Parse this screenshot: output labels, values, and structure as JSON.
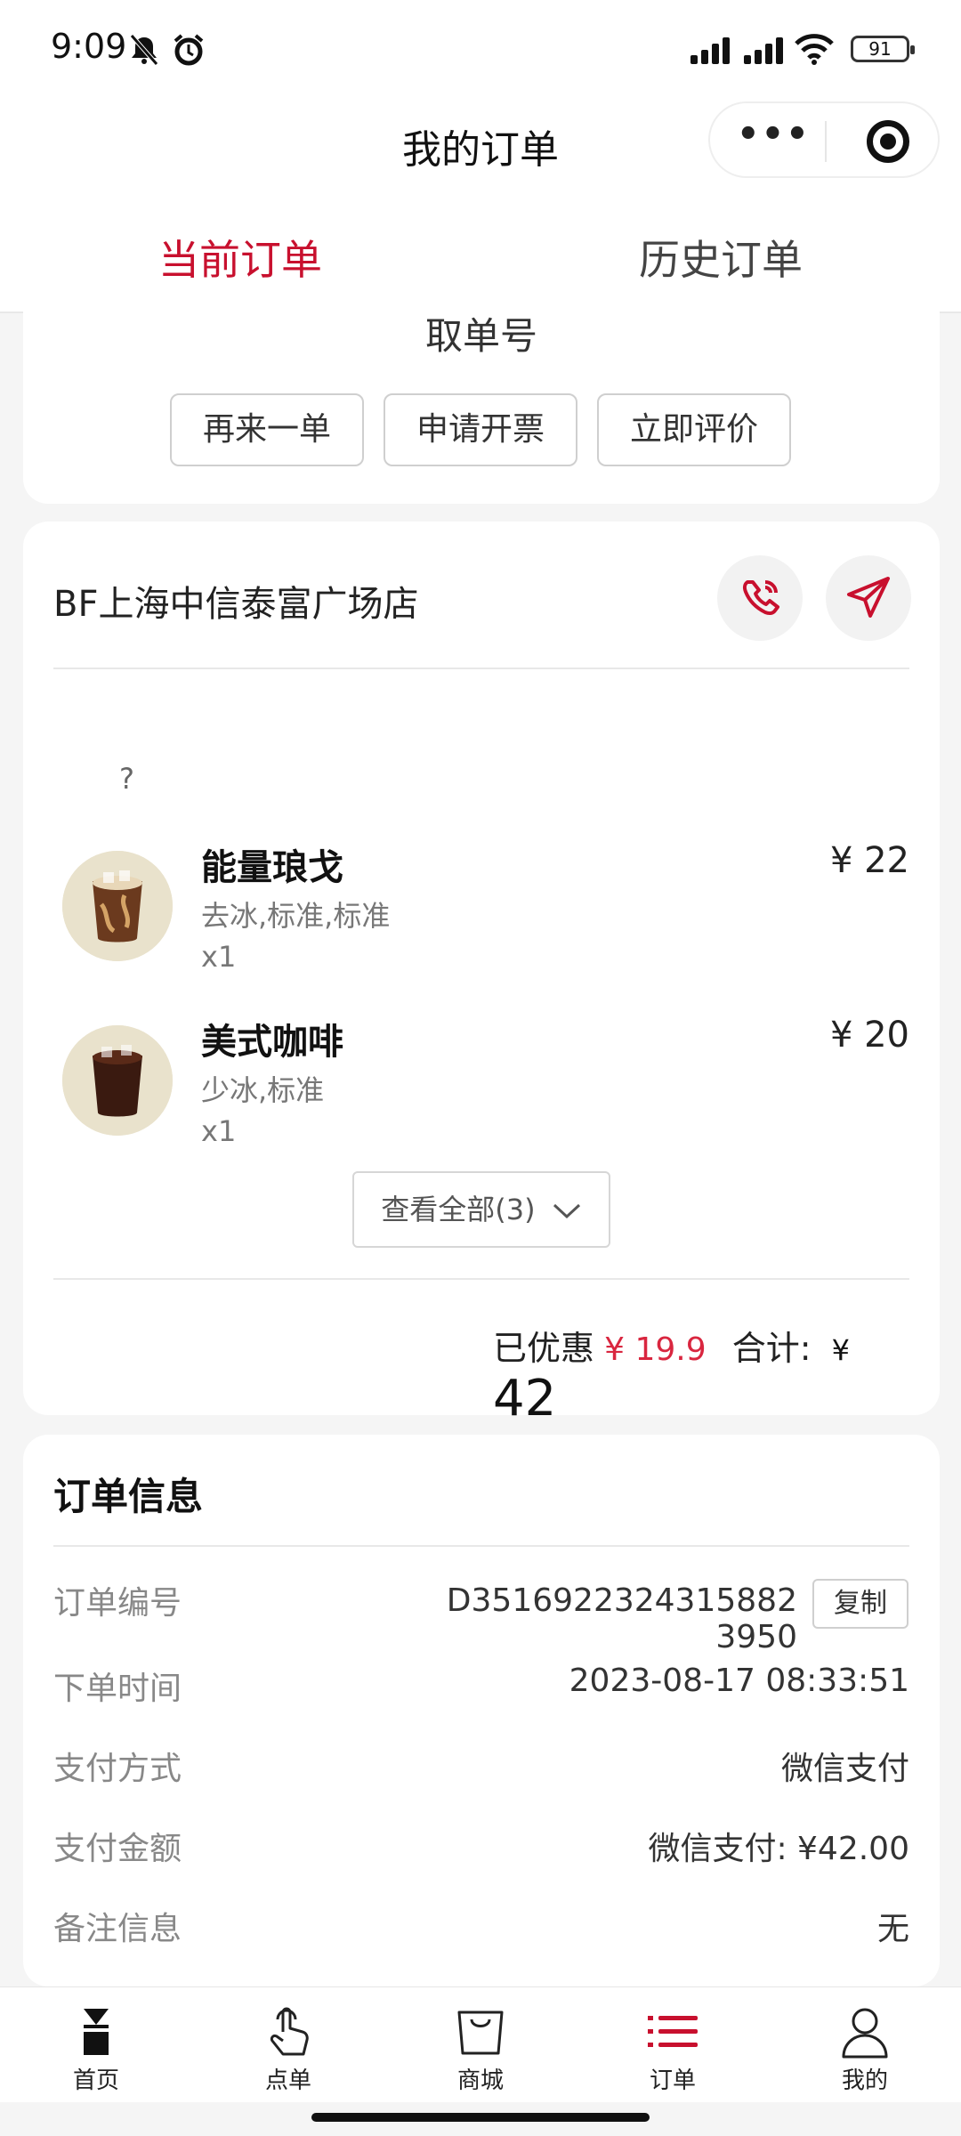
{
  "status_bar": {
    "time": "9:09",
    "battery": "91"
  },
  "navbar": {
    "title": "我的订单",
    "more_icon": "more-dots-icon",
    "target_icon": "target-icon"
  },
  "tabs": [
    {
      "label": "当前订单",
      "active": true
    },
    {
      "label": "历史订单",
      "active": false
    }
  ],
  "pickup": {
    "label": "取单号",
    "buttons": [
      "再来一单",
      "申请开票",
      "立即评价"
    ]
  },
  "store": {
    "name": "BF上海中信泰富广场店",
    "phone_icon": "phone-icon",
    "navigate_icon": "navigation-arrow-icon"
  },
  "placeholder_text": "?",
  "products": [
    {
      "name": "能量琅戈",
      "spec": "去冰,标准,标准",
      "qty": "x1",
      "price": "¥ 22"
    },
    {
      "name": "美式咖啡",
      "spec": "少冰,标准",
      "qty": "x1",
      "price": "¥ 20"
    }
  ],
  "view_all": "查看全部(3)",
  "summary": {
    "discount_label": "已优惠",
    "discount_value": "¥ 19.9",
    "total_label": "合计:",
    "total_currency": "¥",
    "total_value": "42"
  },
  "order_info": {
    "title": "订单信息",
    "rows": [
      {
        "label": "订单编号",
        "value": "D3516922324315882 3950"
      },
      {
        "label": "下单时间",
        "value": "2023-08-17 08:33:51"
      },
      {
        "label": "支付方式",
        "value": "微信支付"
      },
      {
        "label": "支付金额",
        "value": "微信支付: ¥42.00"
      },
      {
        "label": "备注信息",
        "value": "无"
      }
    ],
    "copy_label": "复制"
  },
  "tabbar": [
    {
      "label": "首页",
      "icon": "home-icon",
      "active": false
    },
    {
      "label": "点单",
      "icon": "tap-hand-icon",
      "active": false
    },
    {
      "label": "商城",
      "icon": "shopping-bag-icon",
      "active": false
    },
    {
      "label": "订单",
      "icon": "order-list-icon",
      "active": true
    },
    {
      "label": "我的",
      "icon": "person-icon",
      "active": false
    }
  ],
  "colors": {
    "accent": "#c8102e",
    "background": "#f5f5f5"
  }
}
